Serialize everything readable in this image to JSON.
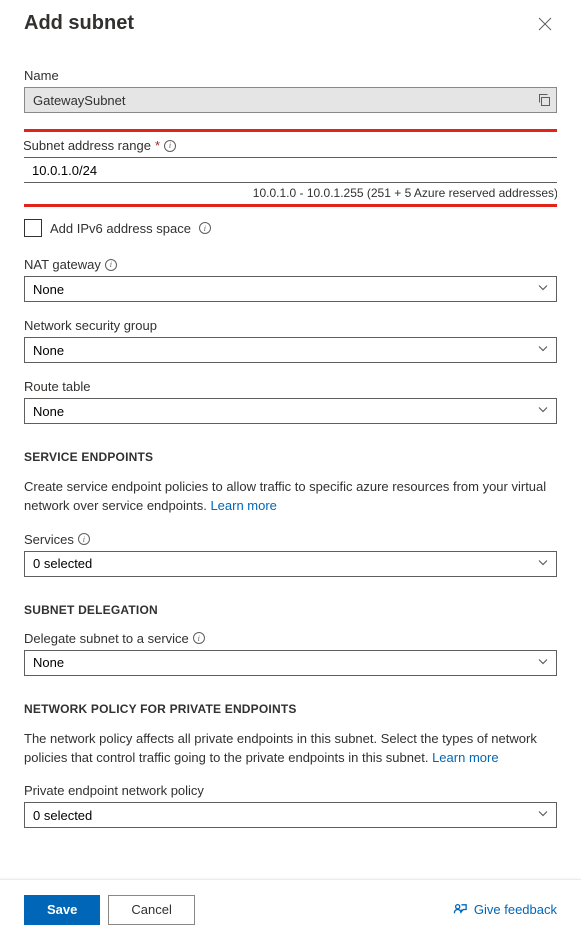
{
  "header": {
    "title": "Add subnet"
  },
  "fields": {
    "name_label": "Name",
    "name_value": "GatewaySubnet",
    "range_label": "Subnet address range",
    "range_value": "10.0.1.0/24",
    "range_helper": "10.0.1.0 - 10.0.1.255 (251 + 5 Azure reserved addresses)",
    "ipv6_label": "Add IPv6 address space",
    "nat_label": "NAT gateway",
    "nat_value": "None",
    "nsg_label": "Network security group",
    "nsg_value": "None",
    "route_label": "Route table",
    "route_value": "None"
  },
  "sections": {
    "service_endpoints": {
      "title": "SERVICE ENDPOINTS",
      "description": "Create service endpoint policies to allow traffic to specific azure resources from your virtual network over service endpoints.",
      "learn_more": "Learn more",
      "services_label": "Services",
      "services_value": "0 selected"
    },
    "delegation": {
      "title": "SUBNET DELEGATION",
      "label": "Delegate subnet to a service",
      "value": "None"
    },
    "network_policy": {
      "title": "NETWORK POLICY FOR PRIVATE ENDPOINTS",
      "description": "The network policy affects all private endpoints in this subnet. Select the types of network policies that control traffic going to the private endpoints in this subnet.",
      "learn_more": "Learn more",
      "label": "Private endpoint network policy",
      "value": "0 selected"
    }
  },
  "footer": {
    "save": "Save",
    "cancel": "Cancel",
    "feedback": "Give feedback"
  }
}
